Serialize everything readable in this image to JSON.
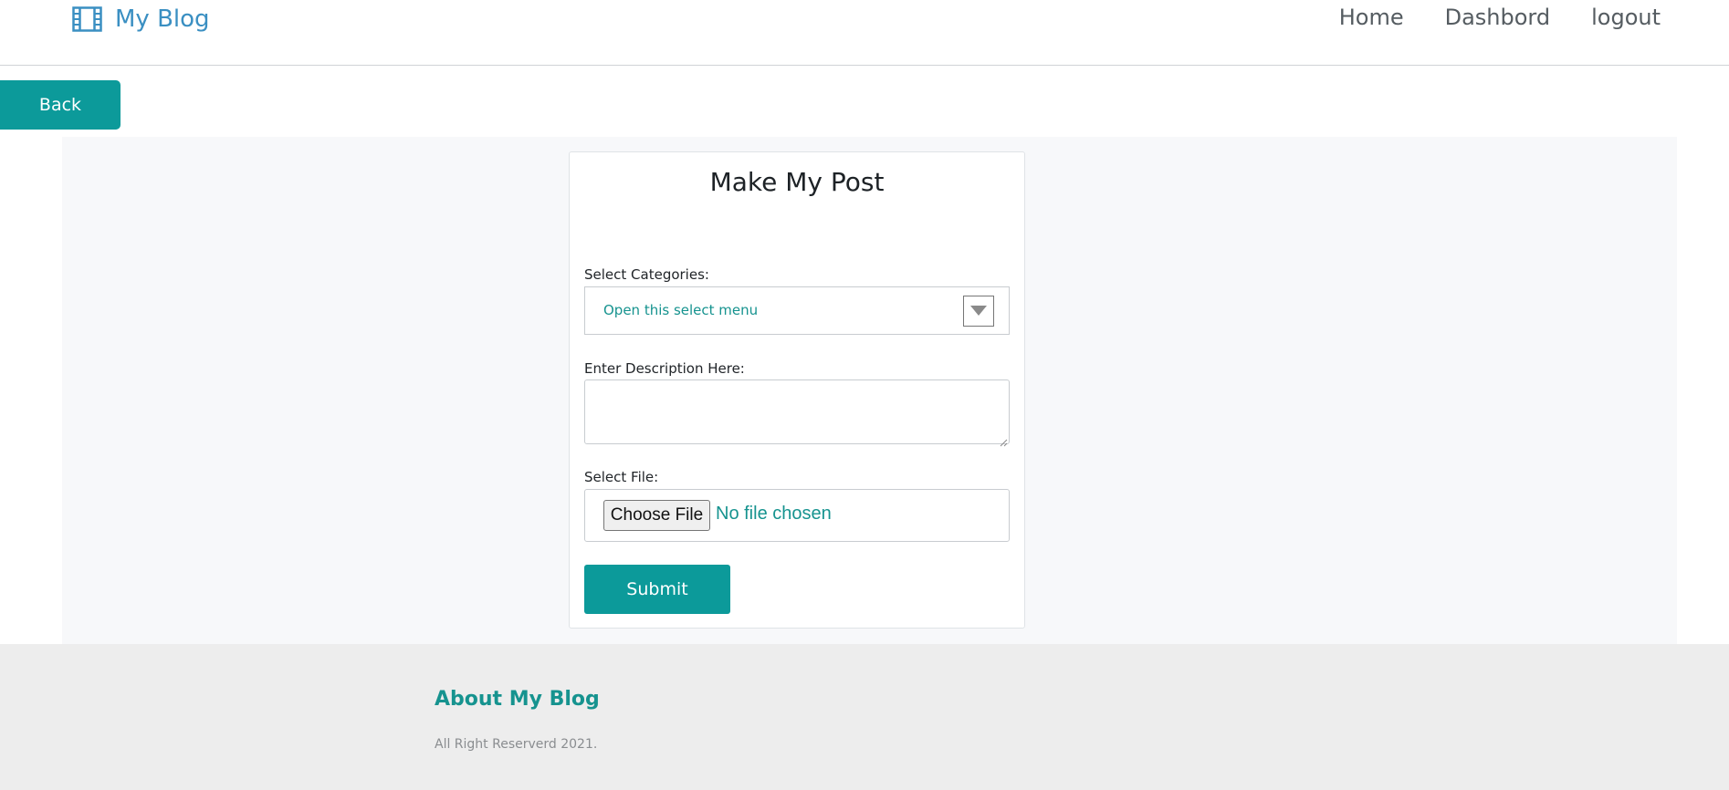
{
  "navbar": {
    "brand": {
      "icon": "film-icon",
      "label": "My Blog"
    },
    "links": [
      {
        "label": "Home"
      },
      {
        "label": "Dashbord"
      },
      {
        "label": "logout"
      }
    ]
  },
  "back_button": {
    "label": "Back"
  },
  "form": {
    "title": "Make My Post",
    "category": {
      "label": "Select Categories:",
      "selected": "Open this select menu",
      "icon": "triangle-down-icon"
    },
    "description": {
      "label": "Enter Description Here:",
      "value": ""
    },
    "file": {
      "label": "Select File:",
      "button_label": "Choose File",
      "status": "No file chosen"
    },
    "submit_label": "Submit"
  },
  "footer": {
    "title": "About My Blog",
    "copyright": "All Right Reserverd 2021."
  },
  "colors": {
    "accent": "#0c9a9a",
    "brand_link": "#3a8fc2",
    "panel_bg": "#f7f8fa",
    "footer_bg": "#ededed"
  }
}
